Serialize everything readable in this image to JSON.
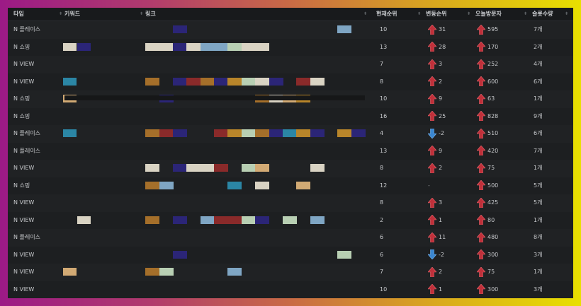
{
  "colors": {
    "navy": "#2b2577",
    "tan": "#a56f2a",
    "teal": "#2b86a5",
    "lightblue": "#7fa6c4",
    "cream": "#d9d3c3",
    "mint": "#b8cfb3",
    "sand": "#d2aa74",
    "crimson": "#8a2a2a",
    "gold": "#b8852a",
    "up": "#c0303a",
    "down": "#3a86d0"
  },
  "headers": {
    "type": "타입",
    "keyword": "키워드",
    "link": "링크",
    "rank": "현재순위",
    "change": "변동순위",
    "visitors": "오늘방문자",
    "slots": "슬롯수량"
  },
  "rows": [
    {
      "type": "N 플레이스",
      "rank": "10",
      "dir": "up",
      "change": "31",
      "visitors": "595",
      "slots": "7개",
      "kw": [],
      "link": [
        [
          244,
          "navy"
        ],
        [
          476,
          "lightblue"
        ]
      ]
    },
    {
      "type": "N 쇼핑",
      "rank": "13",
      "dir": "up",
      "change": "28",
      "visitors": "170",
      "slots": "2개",
      "kw": [
        [
          89,
          "cream"
        ],
        [
          109,
          "navy"
        ]
      ],
      "link": [
        [
          205,
          "cream"
        ],
        [
          225,
          "cream"
        ],
        [
          244,
          "navy"
        ],
        [
          263,
          "cream"
        ],
        [
          283,
          "lightblue"
        ],
        [
          302,
          "lightblue"
        ],
        [
          321,
          "mint"
        ],
        [
          341,
          "cream"
        ],
        [
          360,
          "cream"
        ]
      ]
    },
    {
      "type": "N VIEW",
      "rank": "7",
      "dir": "up",
      "change": "3",
      "visitors": "252",
      "slots": "4개",
      "kw": [],
      "link": []
    },
    {
      "type": "N VIEW",
      "rank": "8",
      "dir": "up",
      "change": "2",
      "visitors": "600",
      "slots": "6개",
      "kw": [
        [
          89,
          "teal"
        ]
      ],
      "link": [
        [
          205,
          "tan"
        ],
        [
          244,
          "navy"
        ],
        [
          263,
          "crimson"
        ],
        [
          283,
          "tan"
        ],
        [
          302,
          "navy"
        ],
        [
          321,
          "gold"
        ],
        [
          341,
          "mint"
        ],
        [
          360,
          "cream"
        ],
        [
          380,
          "navy"
        ],
        [
          418,
          "crimson"
        ],
        [
          438,
          "cream"
        ]
      ]
    },
    {
      "type": "N 쇼핑",
      "rank": "10",
      "dir": "up",
      "change": "9",
      "visitors": "63",
      "slots": "1개",
      "kw": [
        [
          89,
          "sand"
        ]
      ],
      "link": [
        [
          225,
          "navy"
        ],
        [
          360,
          "tan"
        ],
        [
          380,
          "cream"
        ],
        [
          399,
          "sand"
        ],
        [
          418,
          "gold"
        ]
      ]
    },
    {
      "type": "N 쇼핑",
      "rank": "16",
      "dir": "up",
      "change": "25",
      "visitors": "828",
      "slots": "9개",
      "kw": [],
      "link": []
    },
    {
      "type": "N 플레이스",
      "rank": "4",
      "dir": "down",
      "change": "-2",
      "visitors": "510",
      "slots": "6개",
      "kw": [
        [
          89,
          "teal"
        ]
      ],
      "link": [
        [
          205,
          "tan"
        ],
        [
          225,
          "crimson"
        ],
        [
          244,
          "navy"
        ],
        [
          302,
          "crimson"
        ],
        [
          321,
          "gold"
        ],
        [
          341,
          "mint"
        ],
        [
          360,
          "tan"
        ],
        [
          380,
          "navy"
        ],
        [
          399,
          "teal"
        ],
        [
          418,
          "gold"
        ],
        [
          438,
          "navy"
        ],
        [
          476,
          "gold"
        ],
        [
          496,
          "navy"
        ]
      ]
    },
    {
      "type": "N 플레이스",
      "rank": "13",
      "dir": "up",
      "change": "9",
      "visitors": "420",
      "slots": "7개",
      "kw": [],
      "link": []
    },
    {
      "type": "N VIEW",
      "rank": "8",
      "dir": "up",
      "change": "2",
      "visitors": "75",
      "slots": "1개",
      "kw": [],
      "link": [
        [
          205,
          "cream"
        ],
        [
          244,
          "navy"
        ],
        [
          263,
          "cream"
        ],
        [
          283,
          "cream"
        ],
        [
          302,
          "crimson"
        ],
        [
          341,
          "mint"
        ],
        [
          360,
          "sand"
        ],
        [
          438,
          "cream"
        ]
      ]
    },
    {
      "type": "N 쇼핑",
      "rank": "12",
      "dir": "none",
      "change": "-",
      "visitors": "500",
      "slots": "5개",
      "kw": [],
      "link": [
        [
          205,
          "tan"
        ],
        [
          225,
          "lightblue"
        ],
        [
          321,
          "teal"
        ],
        [
          360,
          "cream"
        ],
        [
          418,
          "sand"
        ]
      ]
    },
    {
      "type": "N VIEW",
      "rank": "8",
      "dir": "up",
      "change": "3",
      "visitors": "425",
      "slots": "5개",
      "kw": [],
      "link": []
    },
    {
      "type": "N VIEW",
      "rank": "2",
      "dir": "up",
      "change": "1",
      "visitors": "80",
      "slots": "1개",
      "kw": [
        [
          109,
          "cream"
        ]
      ],
      "link": [
        [
          205,
          "tan"
        ],
        [
          244,
          "navy"
        ],
        [
          283,
          "lightblue"
        ],
        [
          302,
          "crimson"
        ],
        [
          321,
          "crimson"
        ],
        [
          341,
          "mint"
        ],
        [
          360,
          "navy"
        ],
        [
          399,
          "mint"
        ],
        [
          438,
          "lightblue"
        ]
      ]
    },
    {
      "type": "N 플레이스",
      "rank": "6",
      "dir": "up",
      "change": "11",
      "visitors": "480",
      "slots": "8개",
      "kw": [],
      "link": []
    },
    {
      "type": "N VIEW",
      "rank": "6",
      "dir": "down",
      "change": "-2",
      "visitors": "300",
      "slots": "3개",
      "kw": [],
      "link": [
        [
          244,
          "navy"
        ],
        [
          476,
          "mint"
        ]
      ]
    },
    {
      "type": "N VIEW",
      "rank": "7",
      "dir": "up",
      "change": "2",
      "visitors": "75",
      "slots": "1개",
      "kw": [
        [
          89,
          "sand"
        ]
      ],
      "link": [
        [
          205,
          "tan"
        ],
        [
          225,
          "mint"
        ],
        [
          321,
          "lightblue"
        ]
      ]
    },
    {
      "type": "N VIEW",
      "rank": "10",
      "dir": "up",
      "change": "1",
      "visitors": "300",
      "slots": "3개",
      "kw": [],
      "link": []
    }
  ]
}
